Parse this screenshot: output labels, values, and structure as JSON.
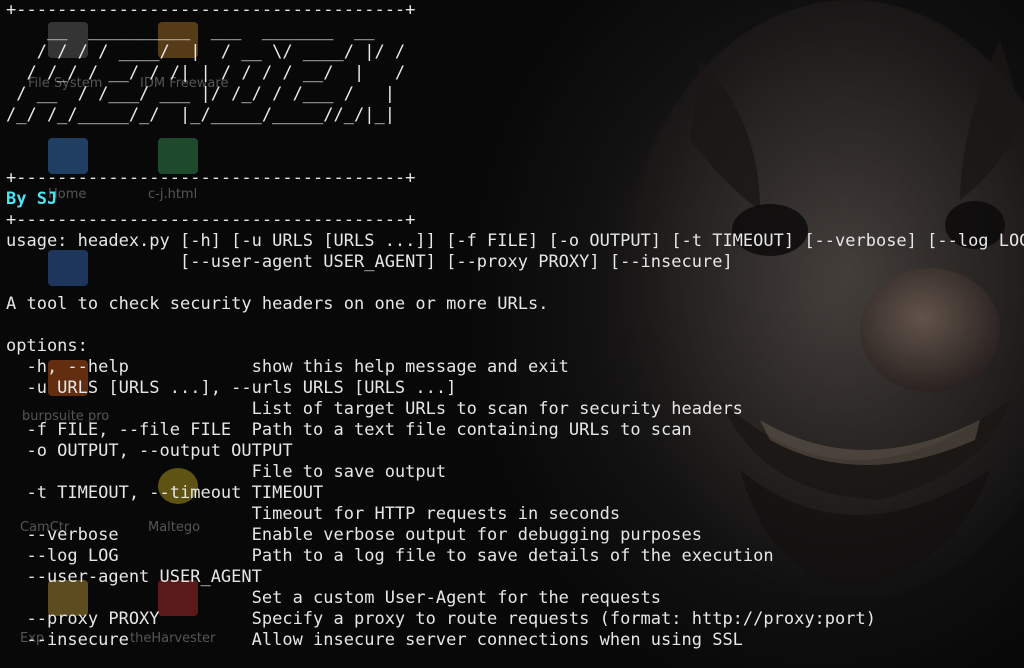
{
  "desktop": {
    "icons": [
      {
        "label": "File System",
        "name": "file-system-icon",
        "color": "#8a8a8a"
      },
      {
        "label": "IDM Freeware",
        "name": "idm-icon",
        "color": "#b37a2a"
      },
      {
        "label": "Home",
        "name": "home-folder-icon",
        "color": "#3f7fd0"
      },
      {
        "label": "c-j.html",
        "name": "html-file-icon",
        "color": "#3a9a5a"
      },
      {
        "label": "",
        "name": "folder-icon",
        "color": "#3a6fc0"
      },
      {
        "label": "burpsuite pro",
        "name": "burpsuite-icon",
        "color": "#d35a1a"
      },
      {
        "label": "Maltego",
        "name": "maltego-icon",
        "color": "#c8b020"
      },
      {
        "label": "CamCtr",
        "name": "camctr-icon",
        "color": "#7a7a7a"
      },
      {
        "label": "Exp",
        "name": "exploit-icon",
        "color": "#c8a040"
      },
      {
        "label": "theHarvester",
        "name": "theharvester-icon",
        "color": "#c03030"
      }
    ]
  },
  "terminal": {
    "separator": "+--------------------------------------+",
    "banner": [
      "    __  __________  ___  _______  __",
      "   / / / / ____/  |  / __ \\/ ____/ |/ /",
      "  / /_/ / __/ / /| | / / / / __/  |   /",
      " / __  / /___/ ___ |/ /_/ / /___ /   |",
      "/_/ /_/_____/_/  |_/_____/_____//_/|_|"
    ],
    "author": "By SJ",
    "usage_line1": "usage: headex.py [-h] [-u URLS [URLS ...]] [-f FILE] [-o OUTPUT] [-t TIMEOUT] [--verbose] [--log LOG]",
    "usage_line2": "                 [--user-agent USER_AGENT] [--proxy PROXY] [--insecure]",
    "description": "A tool to check security headers on one or more URLs.",
    "options_heading": "options:",
    "options": [
      "  -h, --help            show this help message and exit",
      "  -u URLS [URLS ...], --urls URLS [URLS ...]",
      "                        List of target URLs to scan for security headers",
      "  -f FILE, --file FILE  Path to a text file containing URLs to scan",
      "  -o OUTPUT, --output OUTPUT",
      "                        File to save output",
      "  -t TIMEOUT, --timeout TIMEOUT",
      "                        Timeout for HTTP requests in seconds",
      "  --verbose             Enable verbose output for debugging purposes",
      "  --log LOG             Path to a log file to save details of the execution",
      "  --user-agent USER_AGENT",
      "                        Set a custom User-Agent for the requests",
      "  --proxy PROXY         Specify a proxy to route requests (format: http://proxy:port)",
      "  --insecure            Allow insecure server connections when using SSL"
    ],
    "text_color": "#e6e6e6",
    "author_color": "#4fe3f5"
  }
}
